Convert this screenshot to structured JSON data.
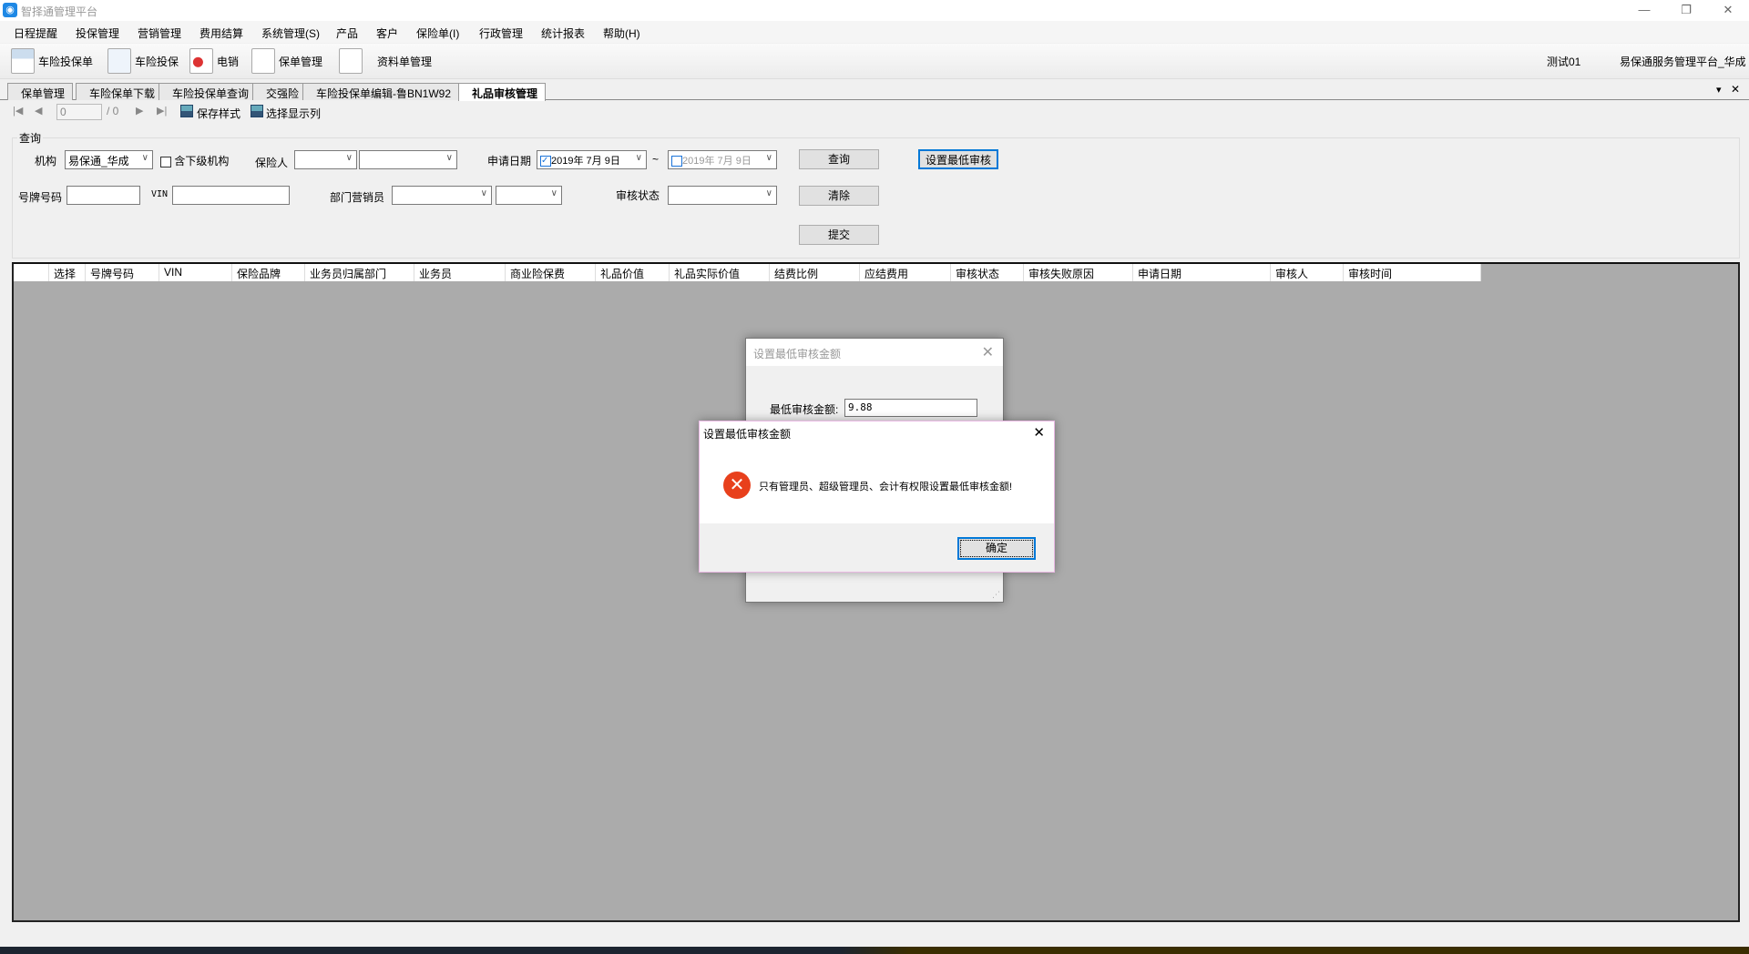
{
  "window": {
    "title": "智择通管理平台",
    "minimize": "—",
    "restore": "❐",
    "close": "✕"
  },
  "menu": [
    "日程提醒",
    "投保管理",
    "营销管理",
    "费用结算",
    "系统管理(S)",
    "产品",
    "客户",
    "保险单(I)",
    "行政管理",
    "统计报表",
    "帮助(H)"
  ],
  "toolbar": {
    "buttons": [
      "车险投保单",
      "车险投保",
      "电销",
      "保单管理",
      "资料单管理"
    ],
    "user": "测试01",
    "org": "易保通服务管理平台_华成"
  },
  "tabs": [
    "保单管理",
    "车险保单下载",
    "车险投保单查询",
    "交强险",
    "车险投保单编辑-鲁BN1W92",
    "礼品审核管理"
  ],
  "tab_controls": {
    "dropdown": "▾",
    "close": "✕"
  },
  "nav": {
    "page": "0",
    "total": "/ 0",
    "save_style": "保存样式",
    "select_cols": "选择显示列"
  },
  "query": {
    "group_title": "查询",
    "org_label": "机构",
    "org_value": "易保通_华成",
    "include_sub": "含下级机构",
    "insurer_label": "保险人",
    "date_label": "申请日期",
    "date_from": "2019年 7月 9日",
    "date_sep": "~",
    "date_to": "2019年 7月 9日",
    "plate_label": "号牌号码",
    "vin_label": "VIN",
    "sales_label": "部门营销员",
    "status_label": "审核状态",
    "btn_query": "查询",
    "btn_clear": "清除",
    "btn_submit": "提交",
    "btn_set_min": "设置最低审核"
  },
  "grid": {
    "columns": [
      "",
      "选择",
      "号牌号码",
      "VIN",
      "保险品牌",
      "业务员归属部门",
      "业务员",
      "商业险保费",
      "礼品价值",
      "礼品实际价值",
      "结费比例",
      "应结费用",
      "审核状态",
      "审核失败原因",
      "申请日期",
      "审核人",
      "审核时间"
    ]
  },
  "dialog_back": {
    "title": "设置最低审核金额",
    "label": "最低审核金额:",
    "value": "9.88",
    "close": "✕"
  },
  "dialog_error": {
    "title": "设置最低审核金额",
    "message": "只有管理员、超级管理员、会计有权限设置最低审核金额!",
    "ok": "确定",
    "close": "✕",
    "icon": "error-icon"
  }
}
